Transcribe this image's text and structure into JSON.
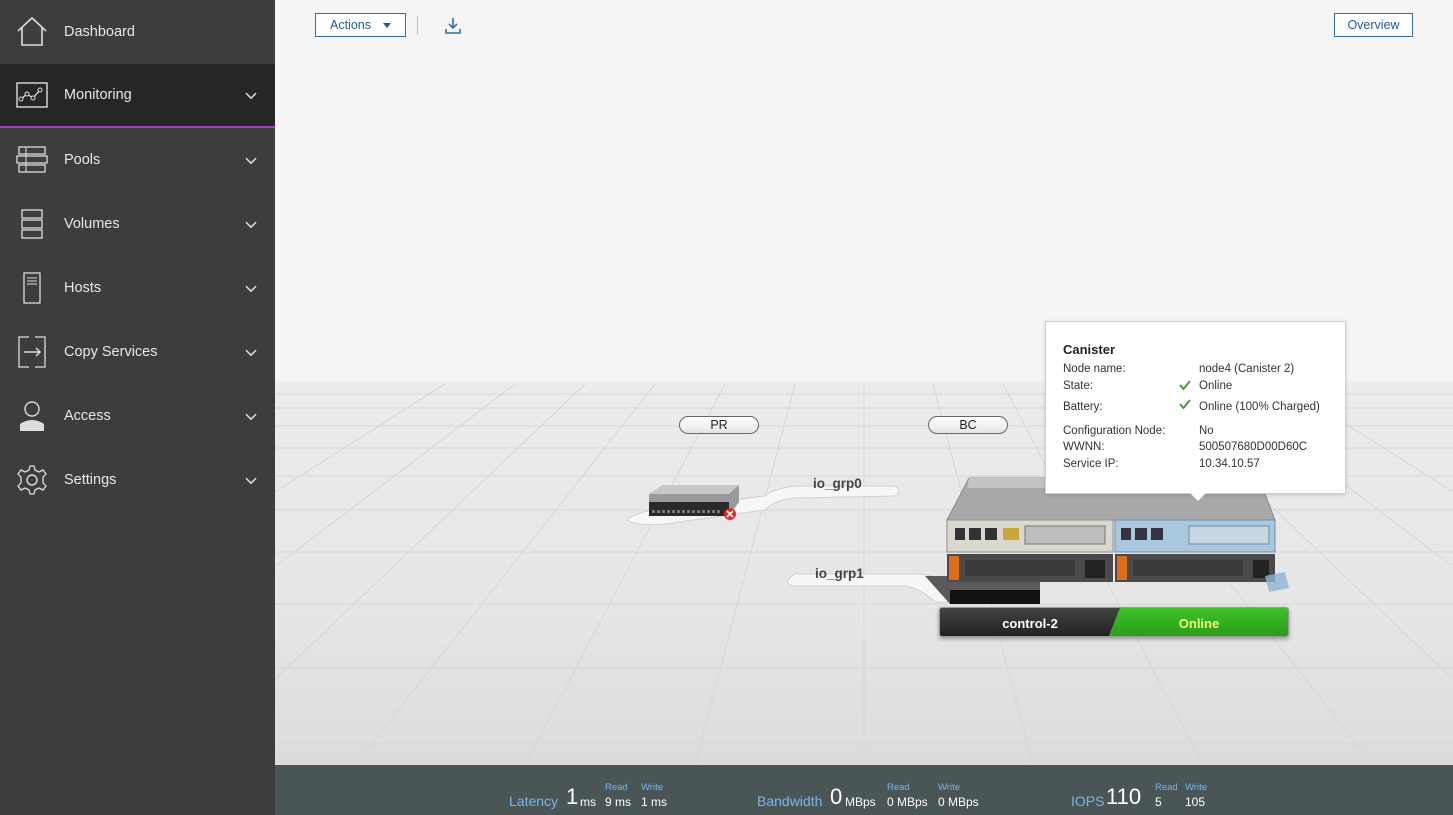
{
  "sidebar": {
    "items": [
      {
        "label": "Dashboard",
        "icon": "home-icon"
      },
      {
        "label": "Monitoring",
        "icon": "monitoring-icon",
        "active": true
      },
      {
        "label": "Pools",
        "icon": "pools-icon"
      },
      {
        "label": "Volumes",
        "icon": "volumes-icon"
      },
      {
        "label": "Hosts",
        "icon": "hosts-icon"
      },
      {
        "label": "Copy Services",
        "icon": "copy-services-icon"
      },
      {
        "label": "Access",
        "icon": "access-icon"
      },
      {
        "label": "Settings",
        "icon": "settings-icon"
      }
    ],
    "accent_color": "#9f3fc2"
  },
  "toolbar": {
    "actions_label": "Actions",
    "overview_label": "Overview",
    "download_icon": "download-icon"
  },
  "system": {
    "sites": [
      {
        "label": "PR"
      },
      {
        "label": "BC"
      }
    ],
    "io_groups": [
      {
        "label": "io_grp0"
      },
      {
        "label": "io_grp1"
      }
    ],
    "node": {
      "name": "control-2",
      "status": "Online",
      "status_color": "#2fb31f"
    }
  },
  "tooltip": {
    "title": "Canister",
    "rows": [
      {
        "key": "Node name:",
        "value": "node4 (Canister 2)"
      },
      {
        "key": "State:",
        "value": "Online"
      },
      {
        "key": "Battery:",
        "value": "Online (100% Charged)"
      },
      {
        "key": "Configuration Node:",
        "value": "No"
      },
      {
        "key": "WWNN:",
        "value": "500507680D00D60C"
      },
      {
        "key": "Service IP:",
        "value": "10.34.10.57"
      }
    ]
  },
  "performance": {
    "latency": {
      "label": "Latency",
      "value": "1",
      "unit": "ms",
      "read_label": "Read",
      "read_value": "9 ms",
      "write_label": "Write",
      "write_value": "1 ms"
    },
    "bandwidth": {
      "label": "Bandwidth",
      "value": "0",
      "unit": "MBps",
      "read_label": "Read",
      "read_value": "0 MBps",
      "write_label": "Write",
      "write_value": "0 MBps"
    },
    "iops": {
      "label": "IOPS",
      "value": "110",
      "read_label": "Read",
      "read_value": "5",
      "write_label": "Write",
      "write_value": "105"
    }
  }
}
